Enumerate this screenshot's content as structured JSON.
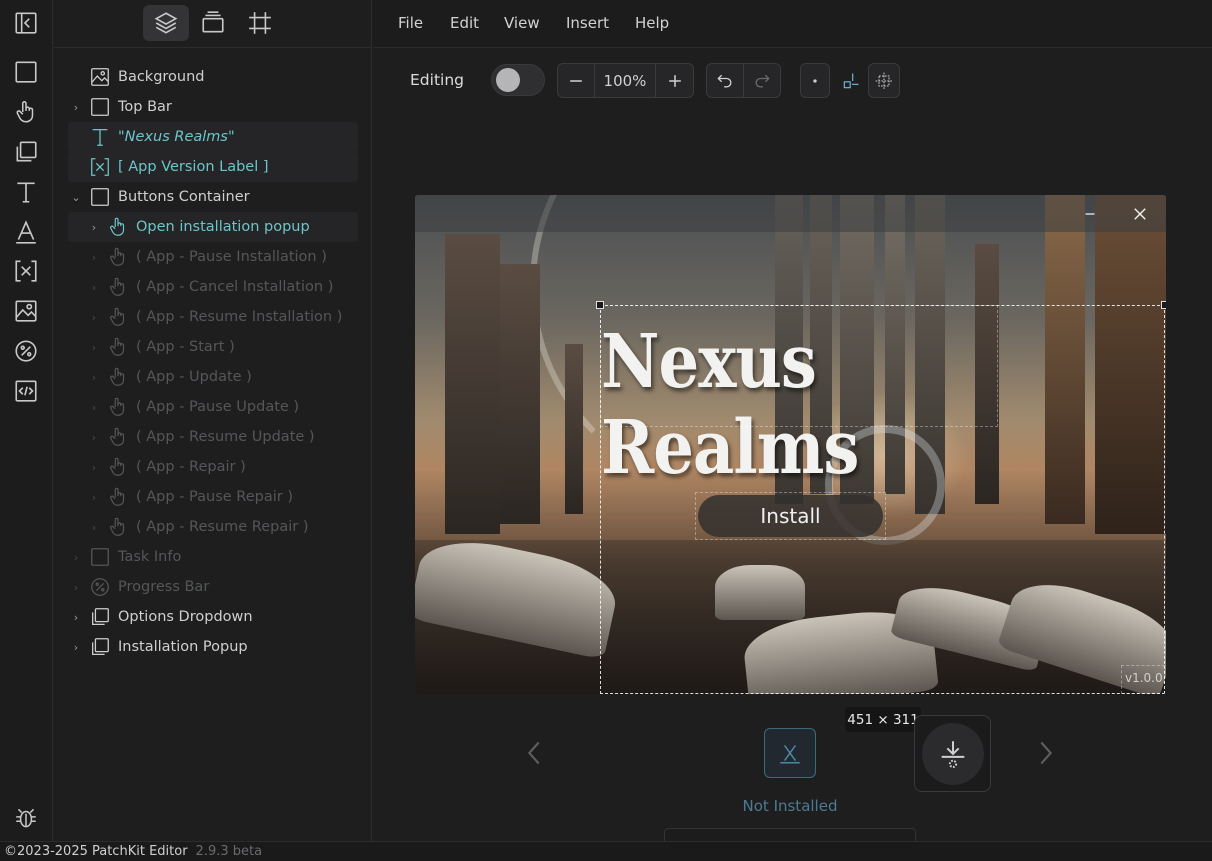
{
  "rail": {
    "tools": [
      "collapse-panel",
      "frame",
      "interaction",
      "component",
      "text",
      "font",
      "variable",
      "image",
      "progress",
      "code",
      "debug"
    ]
  },
  "panel": {
    "tabs": [
      "layers",
      "assets",
      "frames"
    ],
    "layers": [
      {
        "label": "Background",
        "icon": "image-icon",
        "chevron": "",
        "state": "normal"
      },
      {
        "label": "Top Bar",
        "icon": "frame-icon",
        "chevron": "›",
        "state": "normal"
      },
      {
        "label": "\"Nexus Realms\"",
        "icon": "text-icon",
        "chevron": "",
        "state": "selected-text"
      },
      {
        "label": "[ App Version Label ]",
        "icon": "variable-icon",
        "chevron": "",
        "state": "selected"
      },
      {
        "label": "Buttons Container",
        "icon": "frame-icon",
        "chevron": "⌄",
        "state": "normal"
      },
      {
        "label": "Open installation popup",
        "icon": "hand-icon",
        "chevron": "›",
        "state": "selected"
      },
      {
        "label": "( App - Pause Installation )",
        "icon": "hand-icon",
        "chevron": "›",
        "state": "dim"
      },
      {
        "label": "( App - Cancel Installation )",
        "icon": "hand-icon",
        "chevron": "›",
        "state": "dim"
      },
      {
        "label": "( App - Resume Installation )",
        "icon": "hand-icon",
        "chevron": "›",
        "state": "dim"
      },
      {
        "label": "( App - Start )",
        "icon": "hand-icon",
        "chevron": "›",
        "state": "dim"
      },
      {
        "label": "( App - Update )",
        "icon": "hand-icon",
        "chevron": "›",
        "state": "dim"
      },
      {
        "label": "( App - Pause Update )",
        "icon": "hand-icon",
        "chevron": "›",
        "state": "dim"
      },
      {
        "label": "( App - Resume Update )",
        "icon": "hand-icon",
        "chevron": "›",
        "state": "dim"
      },
      {
        "label": "( App - Repair )",
        "icon": "hand-icon",
        "chevron": "›",
        "state": "dim"
      },
      {
        "label": "( App - Pause Repair )",
        "icon": "hand-icon",
        "chevron": "›",
        "state": "dim"
      },
      {
        "label": "( App - Resume Repair )",
        "icon": "hand-icon",
        "chevron": "›",
        "state": "dim"
      },
      {
        "label": "Task Info",
        "icon": "frame-icon",
        "chevron": "›",
        "state": "dim"
      },
      {
        "label": "Progress Bar",
        "icon": "progress-icon",
        "chevron": "›",
        "state": "dim"
      },
      {
        "label": "Options Dropdown",
        "icon": "component-icon",
        "chevron": "›",
        "state": "normal"
      },
      {
        "label": "Installation Popup",
        "icon": "component-icon",
        "chevron": "›",
        "state": "normal"
      }
    ]
  },
  "menubar": {
    "items": [
      "File",
      "Edit",
      "View",
      "Insert",
      "Help"
    ]
  },
  "toolbar": {
    "editing_label": "Editing",
    "zoom": "100%"
  },
  "canvas": {
    "game_title": "Nexus Realms",
    "install_label": "Install",
    "version": "v1.0.0",
    "selection_size": "451 × 311"
  },
  "states": {
    "current_label": "Not Installed"
  },
  "statusbar": {
    "copyright": "©2023-2025 PatchKit Editor",
    "version": "2.9.3 beta"
  },
  "colors": {
    "accent": "#6cc5c9",
    "state_accent": "#4e7a91",
    "background": "#1e1e1f"
  }
}
